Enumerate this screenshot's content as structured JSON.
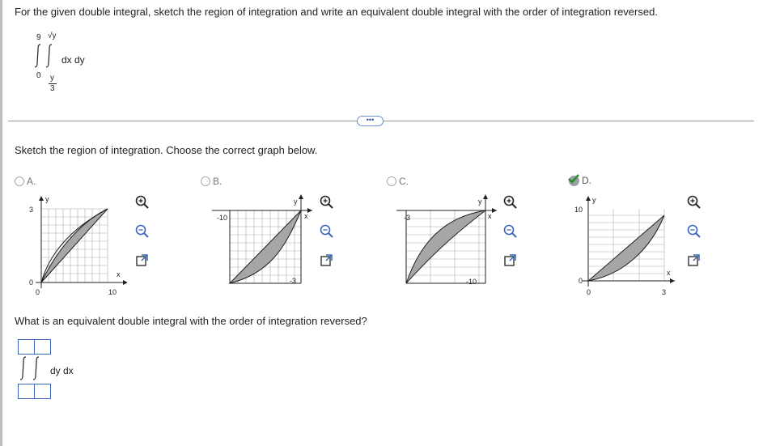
{
  "question": {
    "prompt": "For the given double integral, sketch the region of integration and write an equivalent double integral with the order of integration reversed.",
    "integral": {
      "outer_upper": "9",
      "inner_upper": "√y",
      "outer_lower": "0",
      "inner_lower_num": "y",
      "inner_lower_den": "3",
      "integrand": "dx dy"
    },
    "more_button_label": "•••"
  },
  "sketch": {
    "prompt": "Sketch the region of integration. Choose the correct graph below.",
    "options": [
      {
        "letter": "A.",
        "selected": false,
        "ticks": {
          "y_top": "3",
          "y_bottom": "0",
          "x_origin": "0",
          "x_right": "10"
        },
        "axis_labels": {
          "x": "x",
          "y": "y"
        }
      },
      {
        "letter": "B.",
        "selected": false,
        "ticks": {
          "left": "-10",
          "bottom": "-3"
        },
        "axis_labels": {
          "x": "x",
          "y": "y"
        }
      },
      {
        "letter": "C.",
        "selected": false,
        "ticks": {
          "left": "-3",
          "bottom": "-10"
        },
        "axis_labels": {
          "x": "x",
          "y": "y"
        }
      },
      {
        "letter": "D.",
        "selected": true,
        "ticks": {
          "y_top": "10",
          "y_bottom": "0",
          "x_origin": "0",
          "x_right": "3"
        },
        "axis_labels": {
          "x": "x",
          "y": "y"
        }
      }
    ],
    "tool_icons": [
      "zoom-in-icon",
      "zoom-out-icon",
      "popout-icon"
    ]
  },
  "answer": {
    "prompt": "What is an equivalent double integral with the order of integration reversed?",
    "integrand": "dy dx",
    "outer_upper": "",
    "inner_upper": "",
    "outer_lower": "",
    "inner_lower": ""
  },
  "colors": {
    "accent": "#3b66b8",
    "region_fill": "#a6a6a6",
    "check": "#2e8b2e"
  }
}
